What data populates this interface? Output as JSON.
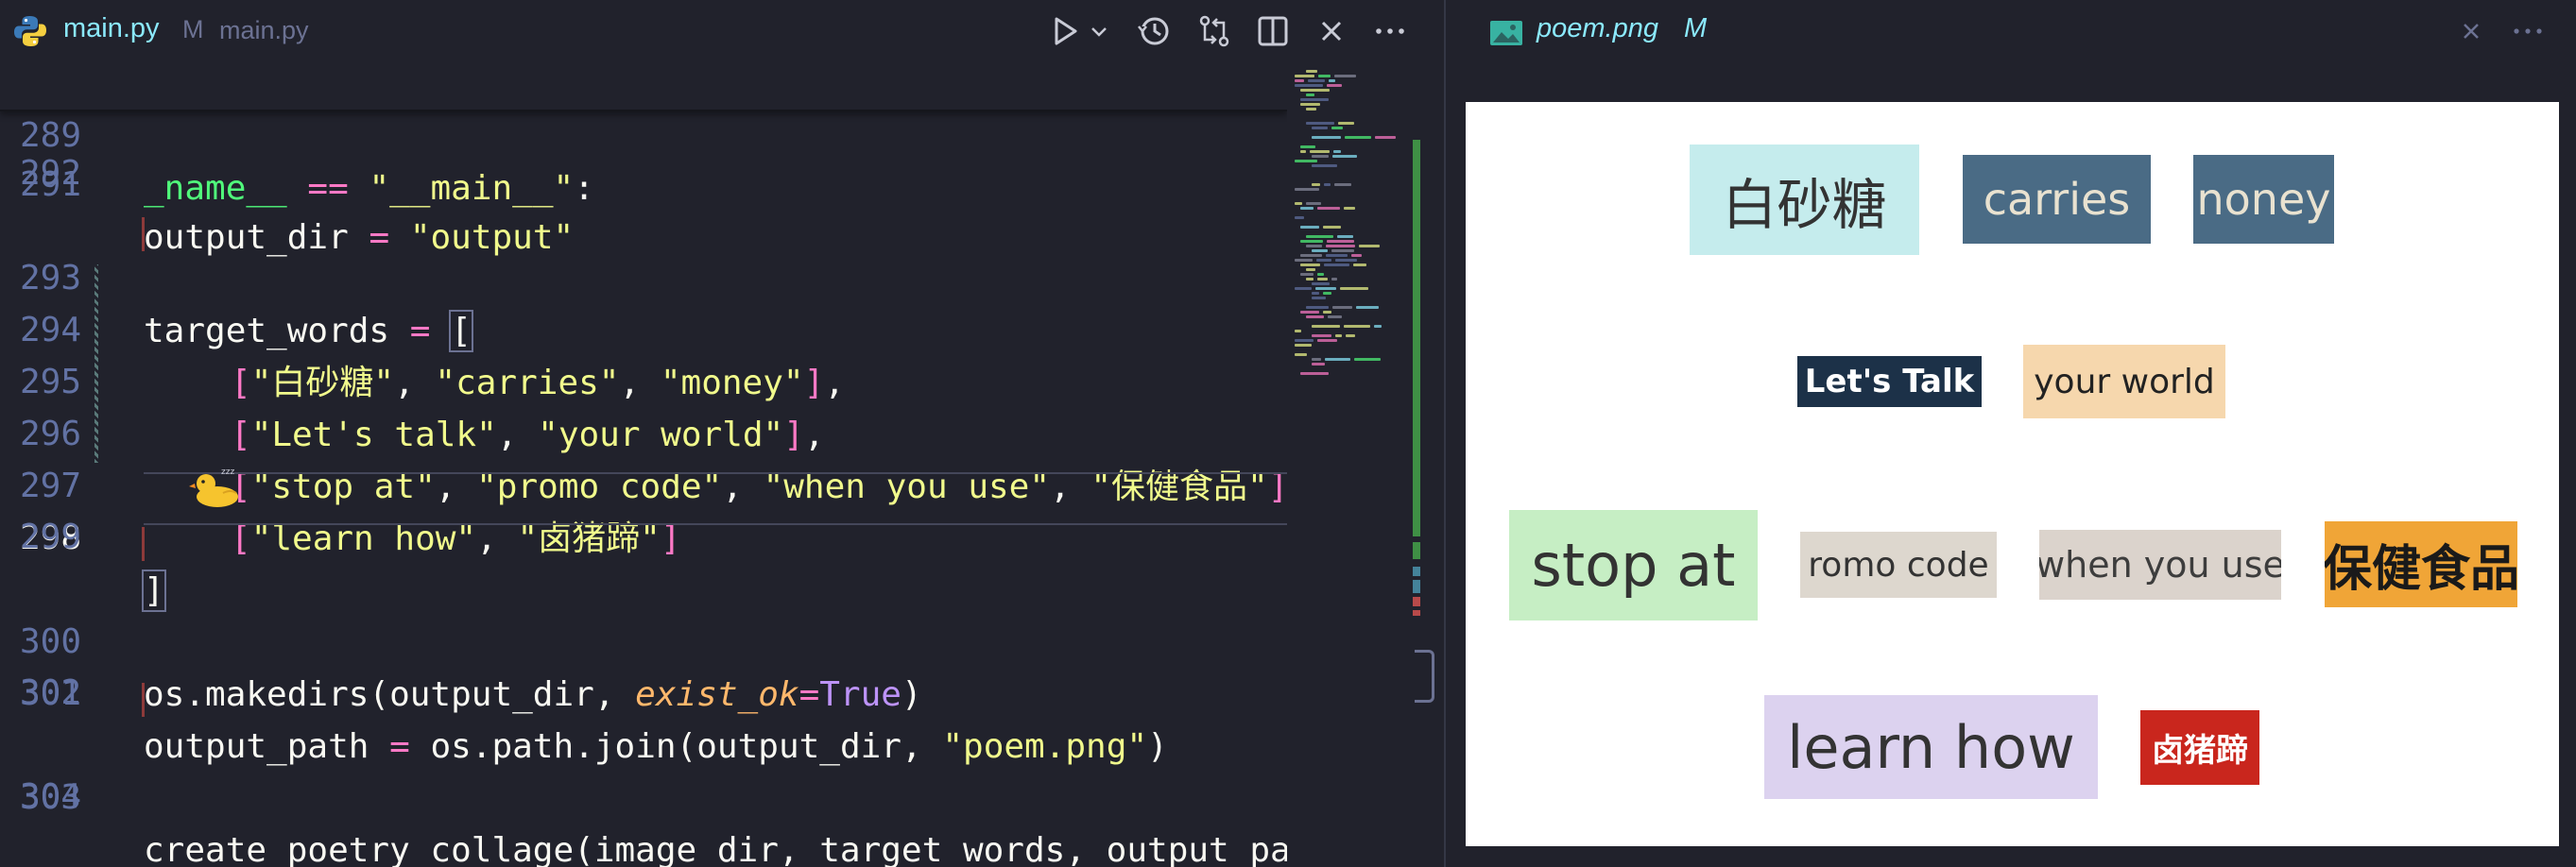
{
  "left_tab": {
    "filename": "main.py",
    "modified": "M",
    "path": "main.py"
  },
  "right_tab": {
    "filename": "poem.png",
    "modified": "M"
  },
  "icons": {
    "tab": "python-icon",
    "toolbar": [
      "run-icon",
      "chevron-down-icon",
      "timeline-icon",
      "compare-changes-icon",
      "split-editor-icon",
      "close-icon",
      "more-actions-icon"
    ],
    "image_tab": "image-icon"
  },
  "editor": {
    "sticky": {
      "num": "289",
      "prefix": "_name__",
      "op": "==",
      "str": "\"__main__\"",
      "colon": ":"
    },
    "line291": {
      "num": "291",
      "var": "output_dir",
      "op": "=",
      "str": "\"output\""
    },
    "line292": {
      "num": "292"
    },
    "line293": {
      "num": "293",
      "var": "target_words",
      "op": "=",
      "bracket": "["
    },
    "line294": {
      "num": "294",
      "open": "[",
      "s1": "\"白砂糖\"",
      "c1": ", ",
      "s2": "\"carries\"",
      "c2": ", ",
      "s3": "\"money\"",
      "close": "]",
      "tail": ","
    },
    "line295": {
      "num": "295",
      "open": "[",
      "s1": "\"Let's talk\"",
      "c1": ", ",
      "s2": "\"your world\"",
      "close": "]",
      "tail": ","
    },
    "line296": {
      "num": "296",
      "open": "[",
      "s1": "\"stop at\"",
      "c1": ", ",
      "s2": "\"promo code\"",
      "c2": ", ",
      "s3": "\"when you use\"",
      "c3": ", ",
      "s4": "\"保健食品\"",
      "close": "]"
    },
    "line297": {
      "num": "297",
      "open": "[",
      "s1": "\"learn how\"",
      "c1": ", ",
      "s2": "\"卤猪蹄\"",
      "close": "]"
    },
    "line298": {
      "num": "298",
      "bracket": "]"
    },
    "line299": {
      "num": "299"
    },
    "line300": {
      "num": "300",
      "fn": "os.makedirs(output_dir, ",
      "kw": "exist_ok",
      "eq": "=",
      "val": "True",
      "end": ")"
    },
    "line301": {
      "num": "301",
      "var": "output_path",
      "op": "=",
      "fn": "os.path.join(output_dir, ",
      "str": "\"poem.png\"",
      "end": ")"
    },
    "line302": {
      "num": "302"
    },
    "line303": {
      "num": "303",
      "code": "create_poetry_collage(image_dir, target_words, output_pa"
    },
    "line304": {
      "num": "304"
    }
  },
  "collage": [
    {
      "text": "白砂糖",
      "bg": "#c5eced",
      "fg": "#333333"
    },
    {
      "text": "carries",
      "bg": "#4a6b85",
      "fg": "#e9e2d0"
    },
    {
      "text": "noney",
      "bg": "#4a6b85",
      "fg": "#e9e2d0"
    },
    {
      "text": "Let's Talk",
      "bg": "#1c3148",
      "fg": "#ffffff"
    },
    {
      "text": "your world",
      "bg": "#f6d7ad",
      "fg": "#222222"
    },
    {
      "text": "stop at",
      "bg": "#c6eec4",
      "fg": "#333333"
    },
    {
      "text": "romo code",
      "bg": "#ddd7ce",
      "fg": "#333333"
    },
    {
      "text": "when you use",
      "bg": "#dbd3cc",
      "fg": "#3d3d3d"
    },
    {
      "text": "保健食品",
      "bg": "#f0a537",
      "fg": "#1a1a1a"
    },
    {
      "text": "learn how",
      "bg": "#dcd2ef",
      "fg": "#333333"
    },
    {
      "text": "卤猪蹄",
      "bg": "#c9261d",
      "fg": "#ffffff"
    }
  ]
}
